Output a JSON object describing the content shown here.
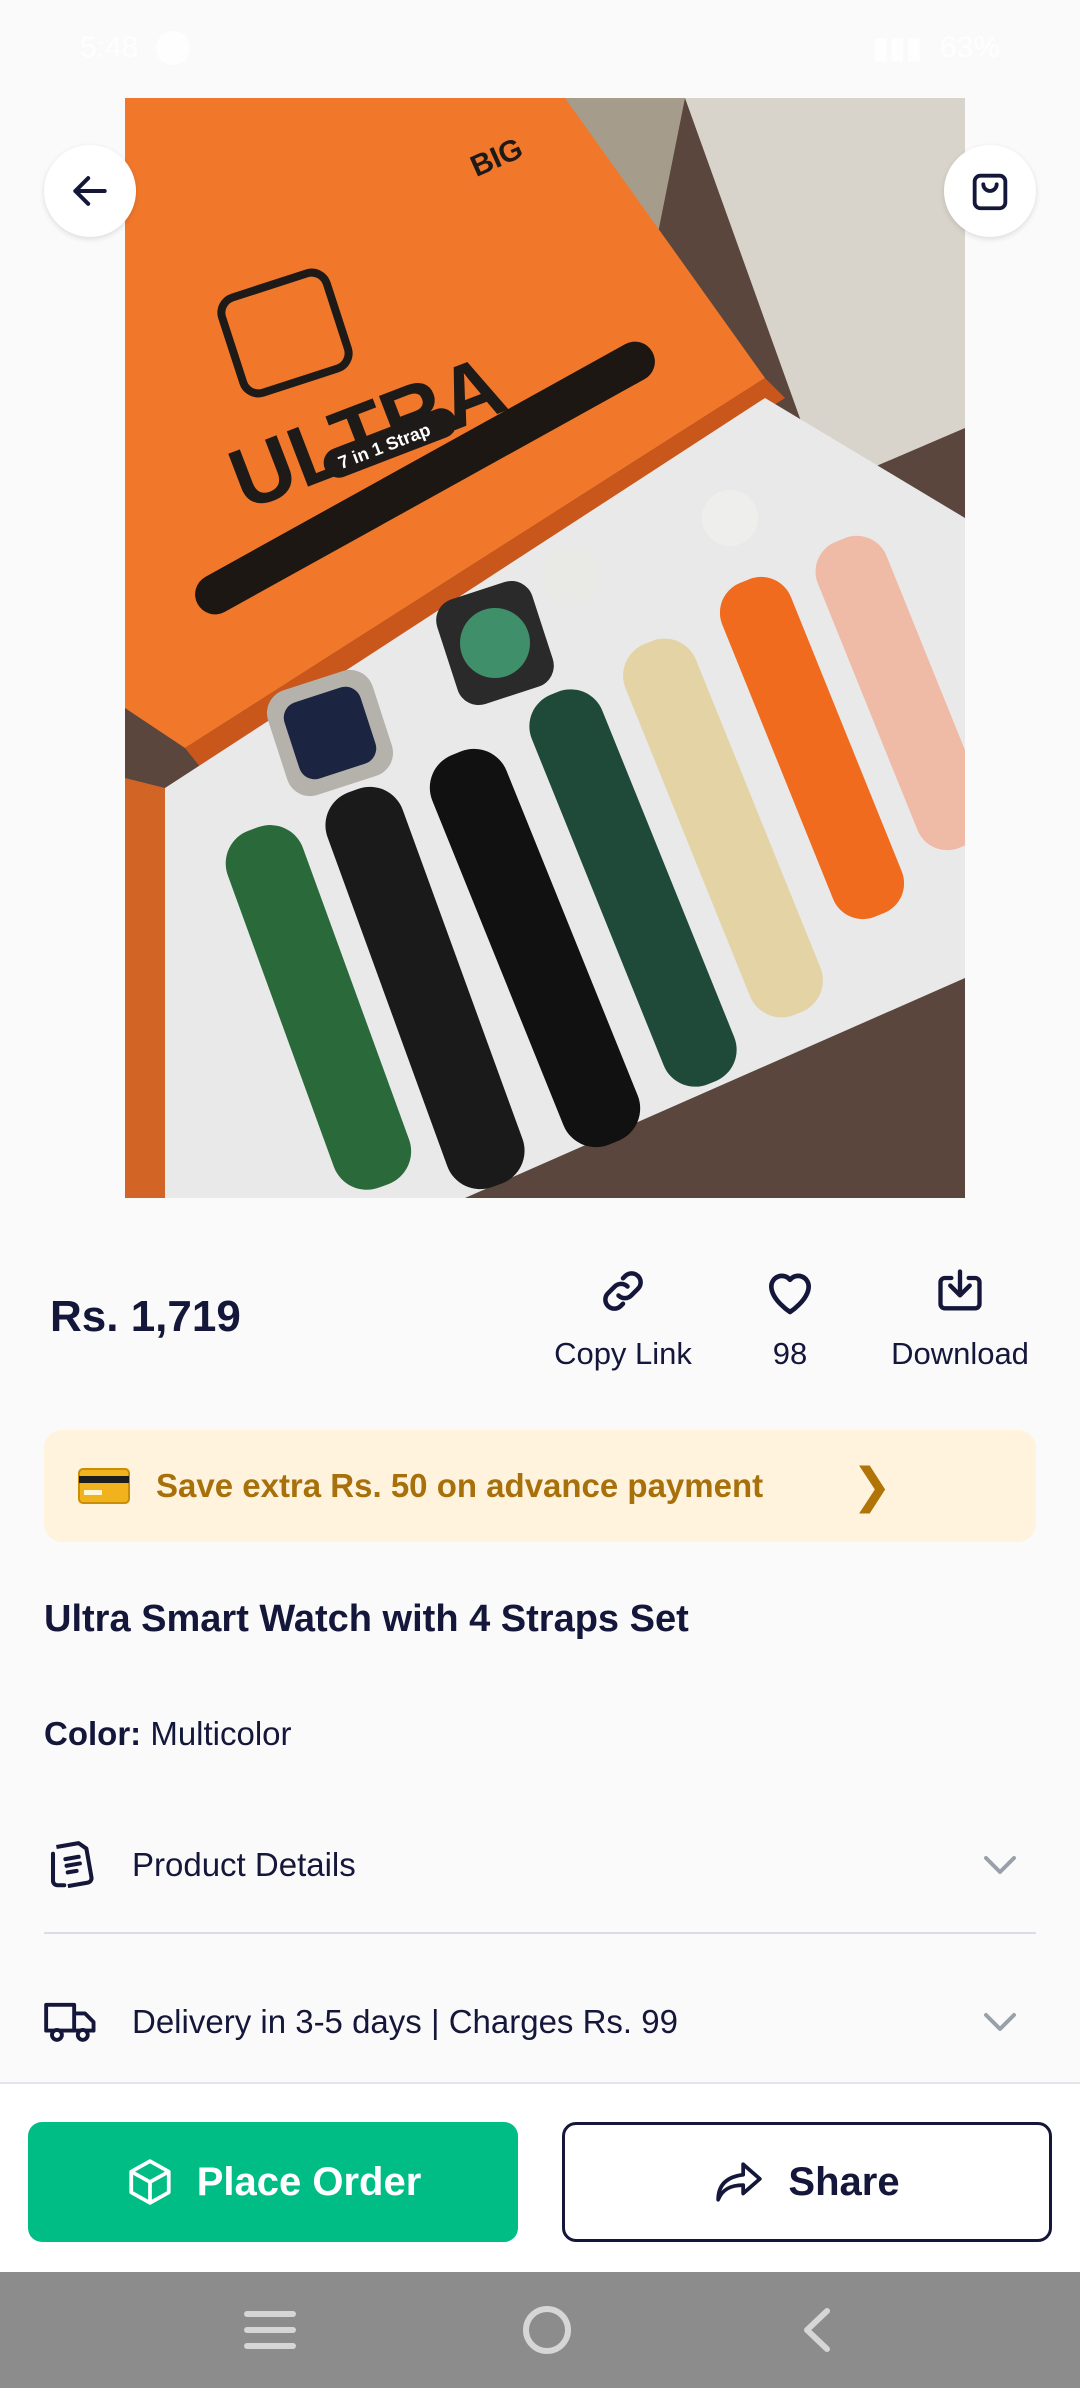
{
  "status_bar": {
    "time": "5:48",
    "battery": "63%"
  },
  "product": {
    "price": "Rs. 1,719",
    "title": "Ultra Smart Watch with 4 Straps Set",
    "color_label": "Color:",
    "color_value": "Multicolor",
    "image_box_text": "ULTRA",
    "image_box_badge": "7 in 1 Strap",
    "image_box_corner": "BIG",
    "carousel": {
      "total": 3,
      "active": 1
    }
  },
  "actions": {
    "copy_link": "Copy Link",
    "likes": "98",
    "download": "Download"
  },
  "promo": {
    "text": "Save extra Rs. 50 on advance payment",
    "accent": "#a8700a",
    "background": "#fff3dd"
  },
  "accordion": [
    {
      "label": "Product Details",
      "icon": "document-icon"
    },
    {
      "label": "Delivery in 3-5 days | Charges Rs. 99",
      "icon": "truck-icon"
    }
  ],
  "bottom_bar": {
    "place_order": "Place Order",
    "share": "Share",
    "primary_color": "#00bd85"
  }
}
